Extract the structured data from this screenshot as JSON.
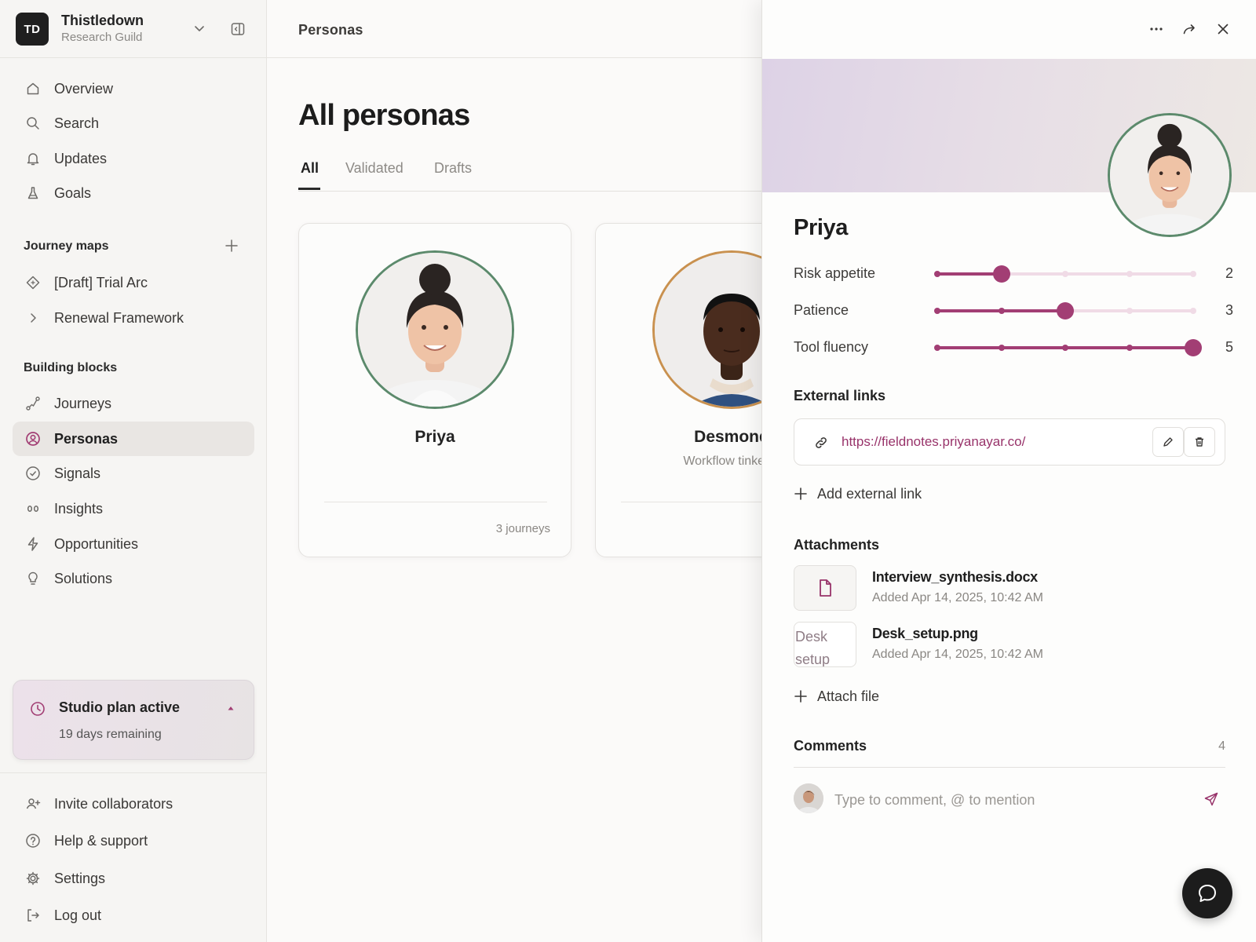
{
  "workspace": {
    "initials": "TD",
    "name": "Thistledown",
    "subtitle": "Research Guild"
  },
  "nav_primary": [
    {
      "label": "Overview",
      "icon": "home-icon"
    },
    {
      "label": "Search",
      "icon": "search-icon"
    },
    {
      "label": "Updates",
      "icon": "bell-icon"
    },
    {
      "label": "Goals",
      "icon": "flask-icon"
    }
  ],
  "journey_maps": {
    "heading": "Journey maps",
    "items": [
      {
        "label": "[Draft] Trial Arc",
        "icon": "diamond-icon"
      },
      {
        "label": "Renewal Framework",
        "icon": "chevron-right-icon"
      }
    ]
  },
  "building_blocks": {
    "heading": "Building blocks",
    "items": [
      {
        "label": "Journeys",
        "icon": "route-icon"
      },
      {
        "label": "Personas",
        "icon": "user-circle-icon",
        "active": true
      },
      {
        "label": "Signals",
        "icon": "check-circle-icon"
      },
      {
        "label": "Insights",
        "icon": "eyes-icon"
      },
      {
        "label": "Opportunities",
        "icon": "bolt-icon"
      },
      {
        "label": "Solutions",
        "icon": "lightbulb-icon"
      }
    ]
  },
  "plan": {
    "title": "Studio plan active",
    "subtitle": "19 days remaining"
  },
  "nav_footer": [
    {
      "label": "Invite collaborators",
      "icon": "user-plus-icon"
    },
    {
      "label": "Help & support",
      "icon": "help-circle-icon"
    },
    {
      "label": "Settings",
      "icon": "gear-icon"
    },
    {
      "label": "Log out",
      "icon": "logout-icon"
    }
  ],
  "main": {
    "breadcrumb": "Personas",
    "title": "All personas",
    "tabs": [
      {
        "label": "All",
        "active": true
      },
      {
        "label": "Validated"
      },
      {
        "label": "Drafts"
      }
    ],
    "cards": [
      {
        "name": "Priya",
        "role": "",
        "footer": "3 journeys",
        "ring_color": "#5c8a6c"
      },
      {
        "name": "Desmond",
        "role": "Workflow tinkerer",
        "footer": "",
        "ring_color": "#c9914f"
      }
    ]
  },
  "panel": {
    "name": "Priya",
    "traits": [
      {
        "label": "Risk appetite",
        "value": 2,
        "max": 5
      },
      {
        "label": "Patience",
        "value": 3,
        "max": 5
      },
      {
        "label": "Tool fluency",
        "value": 5,
        "max": 5
      }
    ],
    "external_links": {
      "heading": "External links",
      "items": [
        {
          "url": "https://fieldnotes.priyanayar.co/"
        }
      ],
      "add_label": "Add external link"
    },
    "attachments": {
      "heading": "Attachments",
      "items": [
        {
          "name": "Interview_synthesis.docx",
          "date": "Added Apr 14, 2025, 10:42 AM",
          "kind": "document"
        },
        {
          "name": "Desk_setup.png",
          "date": "Added Apr 14, 2025, 10:42 AM",
          "kind": "image",
          "alt": "Desk setup"
        }
      ],
      "add_label": "Attach file"
    },
    "comments": {
      "heading": "Comments",
      "count": "4",
      "placeholder": "Type to comment, @ to mention"
    }
  },
  "colors": {
    "accent": "#a23e74",
    "accent_light": "#f0dbe6",
    "link": "#98336a",
    "dark": "#1c1c1c"
  }
}
